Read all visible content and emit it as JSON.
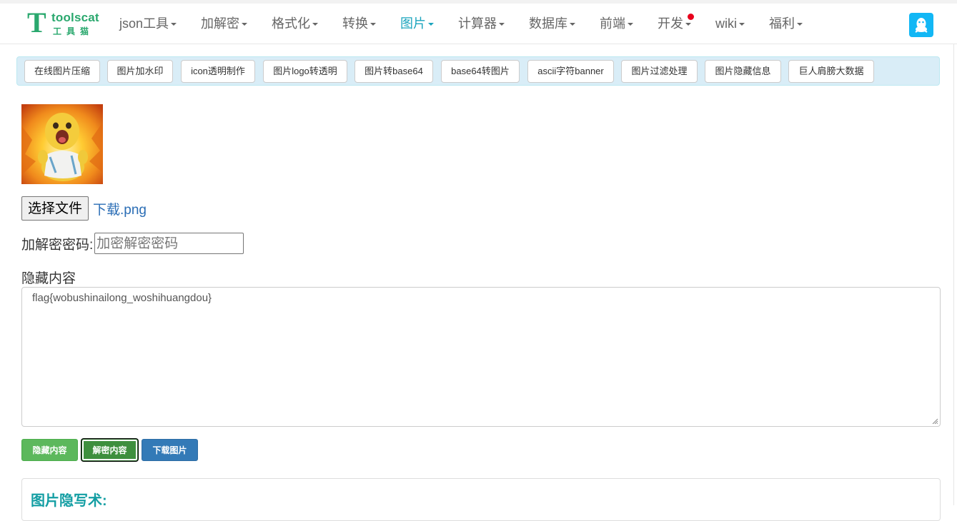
{
  "logo": {
    "letter": "T",
    "word": "toolscat",
    "cn": "工具猫"
  },
  "nav": {
    "items": [
      {
        "label": "json工具",
        "dropdown": true,
        "active": false
      },
      {
        "label": "加解密",
        "dropdown": true,
        "active": false
      },
      {
        "label": "格式化",
        "dropdown": true,
        "active": false
      },
      {
        "label": "转换",
        "dropdown": true,
        "active": false
      },
      {
        "label": "图片",
        "dropdown": true,
        "active": true
      },
      {
        "label": "计算器",
        "dropdown": true,
        "active": false
      },
      {
        "label": "数据库",
        "dropdown": true,
        "active": false
      },
      {
        "label": "前端",
        "dropdown": true,
        "active": false
      },
      {
        "label": "开发",
        "dropdown": true,
        "active": false,
        "badge": "red-dot"
      },
      {
        "label": "wiki",
        "dropdown": true,
        "active": false
      },
      {
        "label": "福利",
        "dropdown": true,
        "active": false
      }
    ],
    "qq_icon": "qq-penguin-icon"
  },
  "tools": [
    "在线图片压缩",
    "图片加水印",
    "icon透明制作",
    "图片logo转透明",
    "图片转base64",
    "base64转图片",
    "ascii字符banner",
    "图片过滤处理",
    "图片隐藏信息",
    "巨人肩膀大数据"
  ],
  "image_preview": {
    "icon": "yellow-cartoon-dinosaur-image"
  },
  "file": {
    "button_label": "选择文件",
    "file_name": "下载.png"
  },
  "password": {
    "label": "加解密密码:",
    "placeholder": "加密解密密码",
    "value": ""
  },
  "hidden_content": {
    "label": "隐藏内容",
    "value": "flag{wobushinailong_woshihuangdou}"
  },
  "actions": {
    "hide": "隐藏内容",
    "decrypt": "解密内容",
    "download": "下载图片"
  },
  "panel": {
    "title": "图片隐写术:"
  },
  "colors": {
    "brand": "#2aa86e",
    "active_nav": "#1ba4bd",
    "btn_green": "#5cb85c",
    "btn_blue": "#337ab7",
    "qq": "#12b7f5",
    "panel_title": "#139ea3"
  }
}
